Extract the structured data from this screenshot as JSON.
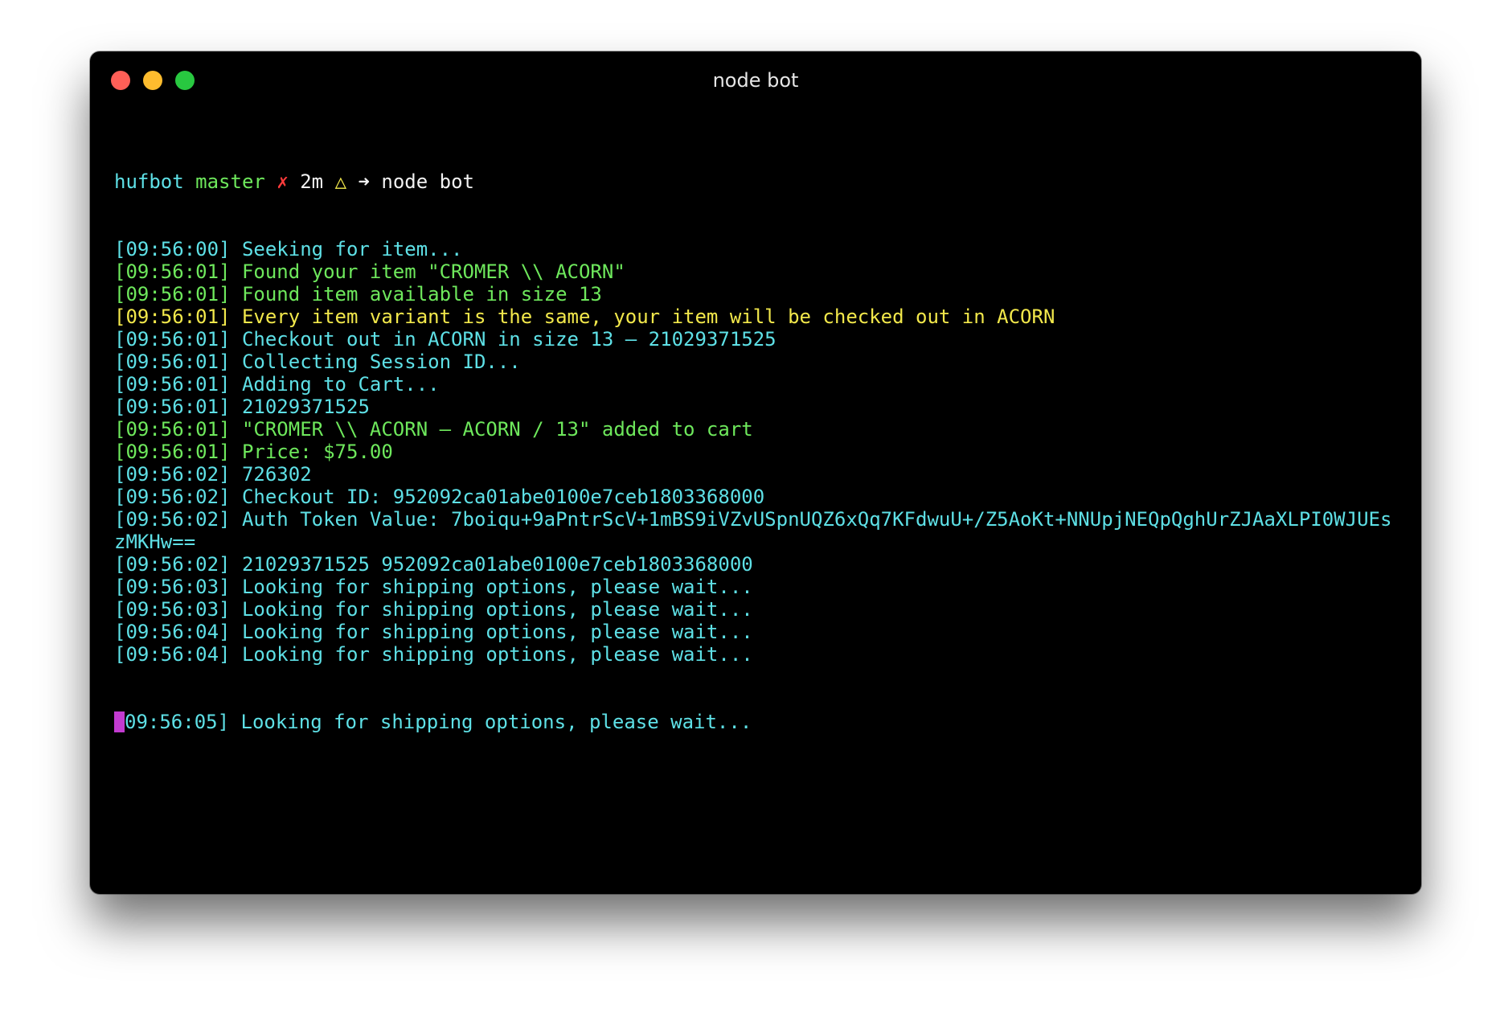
{
  "window": {
    "title": "node bot"
  },
  "prompt": {
    "dir": "hufbot",
    "branch": "master",
    "dirty_mark": "✗",
    "duration": "2m",
    "warn_mark": "△",
    "arrow": "➜",
    "command": "node bot"
  },
  "lines": [
    {
      "ts": "[09:56:00]",
      "msg": "Seeking for item...",
      "color": "cyan"
    },
    {
      "ts": "[09:56:01]",
      "msg": "Found your item \"CROMER \\\\ ACORN\"",
      "color": "green"
    },
    {
      "ts": "[09:56:01]",
      "msg": "Found item available in size 13",
      "color": "green"
    },
    {
      "ts": "[09:56:01]",
      "msg": "Every item variant is the same, your item will be checked out in ACORN",
      "color": "yellow"
    },
    {
      "ts": "[09:56:01]",
      "msg": "Checkout out in ACORN in size 13 – 21029371525",
      "color": "cyan"
    },
    {
      "ts": "[09:56:01]",
      "msg": "Collecting Session ID...",
      "color": "cyan"
    },
    {
      "ts": "[09:56:01]",
      "msg": "Adding to Cart...",
      "color": "cyan"
    },
    {
      "ts": "[09:56:01]",
      "msg": "21029371525",
      "color": "cyan"
    },
    {
      "ts": "[09:56:01]",
      "msg": "\"CROMER \\\\ ACORN – ACORN / 13\" added to cart",
      "color": "green"
    },
    {
      "ts": "[09:56:01]",
      "msg": "Price: $75.00",
      "color": "green"
    },
    {
      "ts": "[09:56:02]",
      "msg": "726302",
      "color": "cyan"
    },
    {
      "ts": "[09:56:02]",
      "msg": "Checkout ID: 952092ca01abe0100e7ceb1803368000",
      "color": "cyan"
    },
    {
      "ts": "[09:56:02]",
      "msg": "Auth Token Value: 7boiqu+9aPntrScV+1mBS9iVZvUSpnUQZ6xQq7KFdwuU+/Z5AoKt+NNUpjNEQpQghUrZJAaXLPI0WJUEszMKHw==",
      "color": "cyan",
      "wrap": true
    },
    {
      "ts": "[09:56:02]",
      "msg": "21029371525 952092ca01abe0100e7ceb1803368000",
      "color": "cyan"
    },
    {
      "ts": "[09:56:03]",
      "msg": "Looking for shipping options, please wait...",
      "color": "cyan"
    },
    {
      "ts": "[09:56:03]",
      "msg": "Looking for shipping options, please wait...",
      "color": "cyan"
    },
    {
      "ts": "[09:56:04]",
      "msg": "Looking for shipping options, please wait...",
      "color": "cyan"
    },
    {
      "ts": "[09:56:04]",
      "msg": "Looking for shipping options, please wait...",
      "color": "cyan"
    }
  ],
  "last_line": {
    "ts_rest": "09:56:05]",
    "msg": "Looking for shipping options, please wait...",
    "color": "cyan"
  },
  "colors": {
    "cyan": "#5ee0e6",
    "green": "#6ee85c",
    "yellow": "#f2e84b",
    "red": "#ff3b3b",
    "cursor": "#c23bd0"
  }
}
